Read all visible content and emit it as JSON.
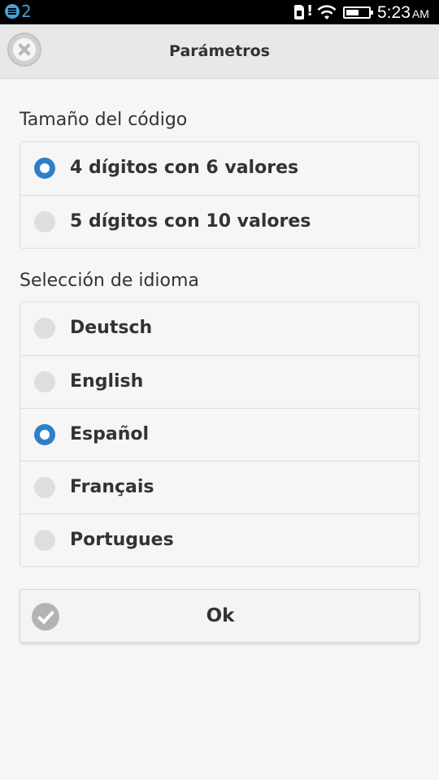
{
  "status_bar": {
    "notification_count": "2",
    "alert_mark": "!",
    "time": "5:23",
    "ampm": "AM",
    "icons": [
      "notification-icon",
      "sim-card-icon",
      "wifi-icon",
      "battery-icon"
    ]
  },
  "header": {
    "title": "Parámetros",
    "close_icon": "close-icon"
  },
  "code_size": {
    "label": "Tamaño del código",
    "options": [
      {
        "label": "4 dígitos con 6 valores",
        "checked": true
      },
      {
        "label": "5 dígitos con 10 valores",
        "checked": false
      }
    ]
  },
  "language": {
    "label": "Selección de idioma",
    "options": [
      {
        "label": "Deutsch",
        "checked": false
      },
      {
        "label": "English",
        "checked": false
      },
      {
        "label": "Español",
        "checked": true
      },
      {
        "label": "Français",
        "checked": false
      },
      {
        "label": "Portugues",
        "checked": false
      }
    ]
  },
  "ok_button": {
    "label": "Ok",
    "icon": "check-icon"
  },
  "colors": {
    "accent": "#2e7fc8",
    "status_accent": "#4a9fd8",
    "background": "#f6f6f6"
  }
}
